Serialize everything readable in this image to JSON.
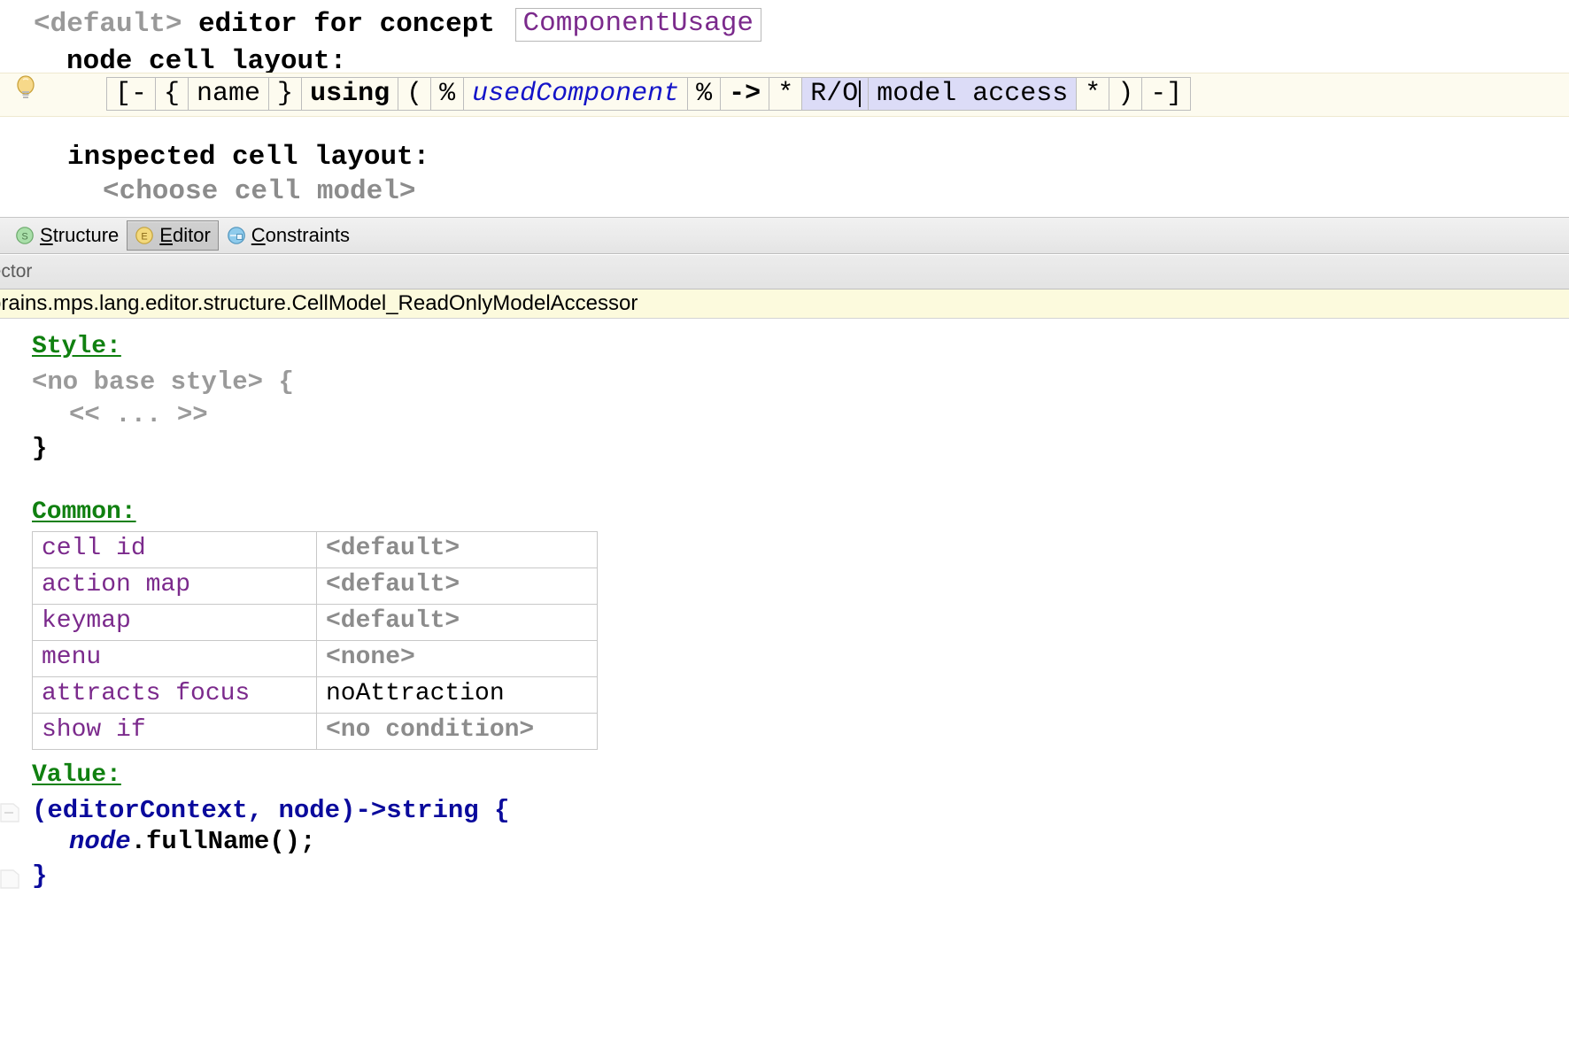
{
  "editor": {
    "title": {
      "default_label": "<default>",
      "middle": "editor for concept",
      "concept": "ComponentUsage"
    },
    "node_cell_layout_label": "node cell layout:",
    "cells": [
      {
        "text": "[-",
        "style": "plain"
      },
      {
        "text": "{",
        "style": "plain"
      },
      {
        "text": "name",
        "style": "plain"
      },
      {
        "text": "}",
        "style": "plain"
      },
      {
        "text": "using",
        "style": "bold"
      },
      {
        "text": "(",
        "style": "plain"
      },
      {
        "text": "%",
        "style": "plain"
      },
      {
        "text": "usedComponent",
        "style": "blue-italic"
      },
      {
        "text": "%",
        "style": "plain"
      },
      {
        "text": "->",
        "style": "bold"
      },
      {
        "text": "*",
        "style": "plain"
      },
      {
        "text": "R/O",
        "style": "selected-caret"
      },
      {
        "text": "model access",
        "style": "selected"
      },
      {
        "text": "*",
        "style": "plain"
      },
      {
        "text": ")",
        "style": "plain"
      },
      {
        "text": "-]",
        "style": "plain"
      }
    ],
    "inspected_cell_layout_label": "inspected cell layout:",
    "choose_cell_model_label": "<choose cell model>"
  },
  "tabs": [
    {
      "label": "Structure",
      "mnemonic": "S",
      "icon": "structure-circle-icon",
      "icon_color": "#9ad89a",
      "selected": false
    },
    {
      "label": "Editor",
      "mnemonic": "E",
      "icon": "editor-circle-icon",
      "icon_color": "#f0d270",
      "selected": true
    },
    {
      "label": "Constraints",
      "mnemonic": "C",
      "icon": "constraints-sphere-icon",
      "icon_color": "#7fc4e8",
      "selected": false
    }
  ],
  "inspector": {
    "panel_title": "pector",
    "concept_path": "brains.mps.lang.editor.structure.CellModel_ReadOnlyModelAccessor"
  },
  "style_section": {
    "heading": "Style:",
    "line1": "<no base style> {",
    "line2": "<< ... >>",
    "line3": "}"
  },
  "common_section": {
    "heading": "Common:",
    "rows": [
      {
        "key": "cell id",
        "value": "<default>",
        "value_tone": "gray"
      },
      {
        "key": "action map",
        "value": "<default>",
        "value_tone": "gray"
      },
      {
        "key": "keymap",
        "value": "<default>",
        "value_tone": "gray"
      },
      {
        "key": "menu",
        "value": "<none>",
        "value_tone": "gray"
      },
      {
        "key": "attracts focus",
        "value": "noAttraction",
        "value_tone": "dark"
      },
      {
        "key": "show if",
        "value": "<no condition>",
        "value_tone": "gray"
      }
    ]
  },
  "value_section": {
    "heading": "Value:",
    "signature": "(editorContext, node)->string {",
    "body_var": "node",
    "body_call": ".fullName();",
    "closing": "}"
  },
  "colors": {
    "heading_green": "#108010",
    "concept_purple": "#7b2a8c",
    "code_blue": "#0a0a9c",
    "gray_text": "#8c8c8c",
    "selection": "#dcdcf7",
    "hint_row": "#fdfbef",
    "concept_bar": "#fcfadd"
  }
}
